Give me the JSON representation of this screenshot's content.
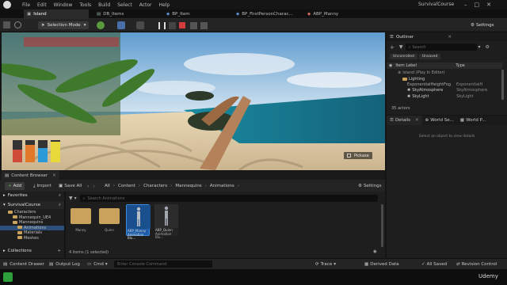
{
  "window": {
    "title": "SurvivalCourse",
    "menu": [
      "File",
      "Edit",
      "Window",
      "Tools",
      "Build",
      "Select",
      "Actor",
      "Help"
    ]
  },
  "tabs": [
    {
      "label": "Island"
    },
    {
      "label": "DB_Items"
    },
    {
      "label": "BP_Item"
    },
    {
      "label": "BP_FirstPersonCharac..."
    },
    {
      "label": "ABP_Manny"
    }
  ],
  "toolbar": {
    "selection_mode": "Selection Mode",
    "settings": "Settings"
  },
  "viewport": {
    "pickaxe_hint": "Pickaxe"
  },
  "outliner": {
    "tab": "Outliner",
    "search_placeholder": "Search",
    "filters": [
      "Unconrolled",
      "Unsaved"
    ],
    "col_label": "Item Label",
    "col_type": "Type",
    "rows": [
      {
        "label": "Island (Play In Editor)",
        "type": ""
      },
      {
        "label": "Lighting",
        "type": ""
      },
      {
        "label": "ExponentialHeightFog",
        "type": "ExponentialH"
      },
      {
        "label": "SkyAtmosphere",
        "type": "SkyAtmosphere"
      },
      {
        "label": "SkyLight",
        "type": "SkyLight"
      }
    ],
    "count": "35 actors"
  },
  "details": {
    "tabs": [
      "Details",
      "World Se...",
      "World P..."
    ],
    "empty_text": "Select an object to view details"
  },
  "content_browser": {
    "tab": "Content Browser",
    "add": "Add",
    "import": "Import",
    "save_all": "Save All",
    "path": [
      "All",
      "Content",
      "Characters",
      "Mannequins",
      "Animations"
    ],
    "settings": "Settings",
    "favorites": "Favorites",
    "project": "SurvivalCourse",
    "tree": [
      "Characters",
      "Mannequin_UE4",
      "Mannequins",
      "Animations",
      "Materials",
      "Meshes"
    ],
    "collections": "Collections",
    "search_placeholder": "Search Animations",
    "assets": [
      {
        "name": "Manny",
        "kind": "folder"
      },
      {
        "name": "Quinn",
        "kind": "folder"
      },
      {
        "name": "ABP_Manny",
        "sub": "Animation Blu...",
        "kind": "abp"
      },
      {
        "name": "ABP_Quinn",
        "sub": "Animation Blu...",
        "kind": "abp"
      }
    ],
    "status": "4 items (1 selected)"
  },
  "statusbar": {
    "content_drawer": "Content Drawer",
    "output_log": "Output Log",
    "cmd": "Cmd",
    "console_placeholder": "Enter Console Command",
    "trace": "Trace",
    "derived_data": "Derived Data",
    "all_saved": "All Saved",
    "revision_control": "Revision Control"
  },
  "watermark": "Udemy",
  "colors": {
    "accent_blue": "#0070e0",
    "play_green": "#2e9e3a",
    "stop_red": "#d23c3c",
    "folder": "#c9a35c"
  }
}
